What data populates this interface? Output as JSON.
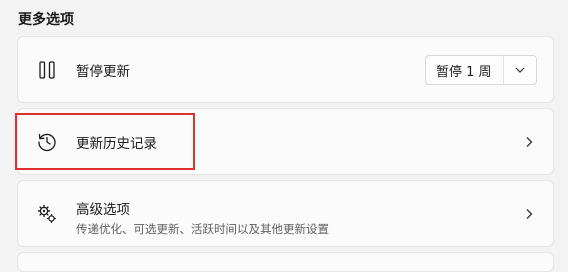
{
  "section": {
    "title": "更多选项"
  },
  "pause_updates": {
    "label": "暂停更新",
    "icon": "pause-icon",
    "dropdown_value": "暂停 1 周",
    "dropdown_icon": "chevron-down-icon"
  },
  "update_history": {
    "label": "更新历史记录",
    "icon": "history-icon",
    "chevron": "chevron-right-icon",
    "highlight_color": "#e0302d"
  },
  "advanced_options": {
    "label": "高级选项",
    "description": "传递优化、可选更新、活跃时间以及其他更新设置",
    "icon": "gears-icon",
    "chevron": "chevron-right-icon"
  },
  "colors": {
    "background": "#f3f3f3",
    "card": "#fbfbfb",
    "highlight": "#e0302d"
  }
}
